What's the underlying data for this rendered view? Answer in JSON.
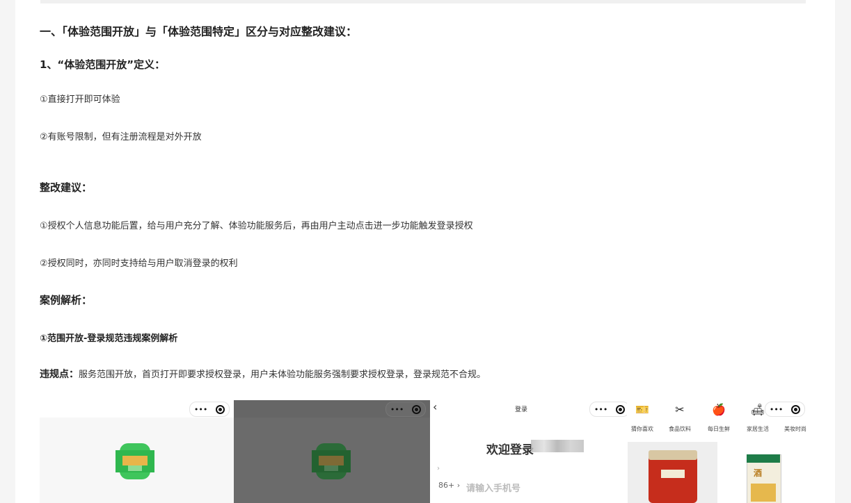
{
  "headings": {
    "main": "一、「体验范围开放」与「体验范围特定」区分与对应整改建议：",
    "definition": "1、“体验范围开放”定义：",
    "suggestion": "整改建议：",
    "case": "案例解析：",
    "case_sub": "①范围开放-登录规范违规案例解析"
  },
  "definition_items": [
    "①直接打开即可体验",
    "②有账号限制，但有注册流程是对外开放"
  ],
  "suggestion_items": [
    "①授权个人信息功能后置，给与用户充分了解、体验功能服务后，再由用户主动点击进一步功能触发登录授权",
    "②授权同时，亦同时支持给与用户取消登录的权利"
  ],
  "violation": {
    "label": "违规点：",
    "text": "服务范围开放，首页打开即要求授权登录，用户未体验功能服务强制要求授权登录，登录规范不合规。"
  },
  "screens": {
    "capsule_dots": "•••",
    "login": {
      "back": "‹",
      "title": "登录",
      "welcome": "欢迎登录",
      "arrow": "›",
      "country_code": "86+ ›",
      "phone_placeholder": "请输入手机号"
    },
    "categories": [
      {
        "icon": "ticket-icon",
        "glyph": "🎫",
        "label": "猜你喜欢"
      },
      {
        "icon": "utensils-icon",
        "glyph": "✂",
        "label": "食品饮料"
      },
      {
        "icon": "apple-icon",
        "glyph": "🍎",
        "label": "每日生鲜"
      },
      {
        "icon": "sofa-icon",
        "glyph": "🛋",
        "label": "家居生活"
      },
      {
        "icon": "beauty-icon",
        "glyph": "💄",
        "label": "美妆时尚"
      }
    ],
    "product2_text": "酒"
  },
  "colors": {
    "accent_green": "#2fb74f",
    "jar_red": "#c62d1c"
  }
}
